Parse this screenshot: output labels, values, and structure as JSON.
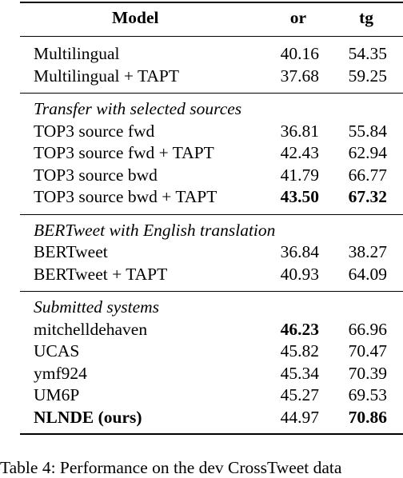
{
  "table": {
    "headers": {
      "model": "Model",
      "or": "or",
      "tg": "tg"
    },
    "baseline_rows": [
      {
        "model": "Multilingual",
        "or": "40.16",
        "tg": "54.35",
        "bold": []
      },
      {
        "model": "Multilingual + TAPT",
        "or": "37.68",
        "tg": "59.25",
        "bold": []
      }
    ],
    "groups": [
      {
        "title": "Transfer with selected sources",
        "rows": [
          {
            "model": "TOP3 source fwd",
            "or": "36.81",
            "tg": "55.84",
            "bold": []
          },
          {
            "model": "TOP3 source fwd + TAPT",
            "or": "42.43",
            "tg": "62.94",
            "bold": []
          },
          {
            "model": "TOP3 source bwd",
            "or": "41.79",
            "tg": "66.77",
            "bold": []
          },
          {
            "model": "TOP3 source bwd + TAPT",
            "or": "43.50",
            "tg": "67.32",
            "bold": [
              "or",
              "tg"
            ]
          }
        ]
      },
      {
        "title": "BERTweet with English translation",
        "rows": [
          {
            "model": "BERTweet",
            "or": "36.84",
            "tg": "38.27",
            "bold": []
          },
          {
            "model": "BERTweet + TAPT",
            "or": "40.93",
            "tg": "64.09",
            "bold": []
          }
        ]
      },
      {
        "title": "Submitted systems",
        "rows": [
          {
            "model": "mitchelldehaven",
            "or": "46.23",
            "tg": "66.96",
            "bold": [
              "or"
            ]
          },
          {
            "model": "UCAS",
            "or": "45.82",
            "tg": "70.47",
            "bold": []
          },
          {
            "model": "ymf924",
            "or": "45.34",
            "tg": "70.39",
            "bold": []
          },
          {
            "model": "UM6P",
            "or": "45.27",
            "tg": "69.53",
            "bold": []
          },
          {
            "model": "NLNDE (ours)",
            "or": "44.97",
            "tg": "70.86",
            "bold": [
              "model",
              "tg"
            ]
          }
        ]
      }
    ]
  },
  "caption": "Table 4: Performance on the dev CrossTweet data"
}
